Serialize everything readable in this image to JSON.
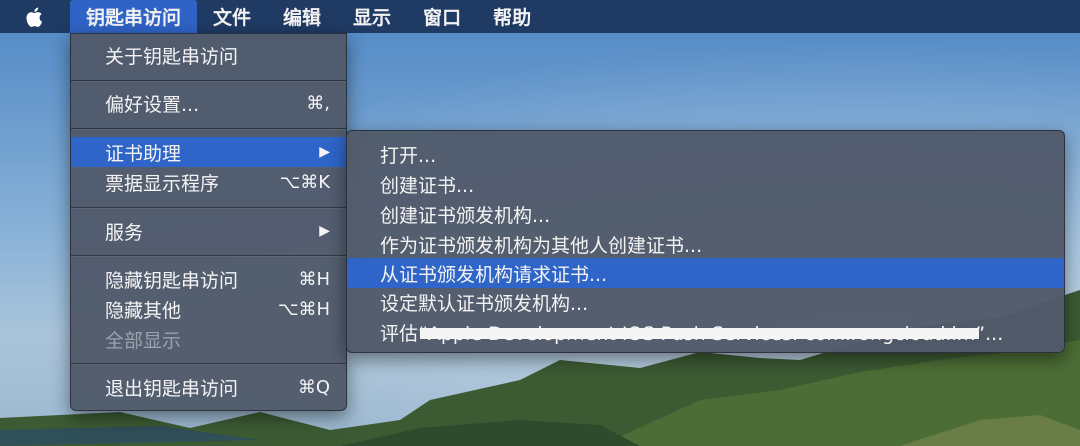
{
  "menubar": {
    "apple_icon": "apple-logo-icon",
    "items": [
      "钥匙串访问",
      "文件",
      "编辑",
      "显示",
      "窗口",
      "帮助"
    ]
  },
  "app_menu": {
    "items": [
      {
        "label": "关于钥匙串访问",
        "shortcut": ""
      },
      {
        "label": "偏好设置...",
        "shortcut": "⌘,"
      },
      {
        "label": "证书助理",
        "shortcut": "▶"
      },
      {
        "label": "票据显示程序",
        "shortcut": "⌥⌘K"
      },
      {
        "label": "服务",
        "shortcut": "▶"
      },
      {
        "label": "隐藏钥匙串访问",
        "shortcut": "⌘H"
      },
      {
        "label": "隐藏其他",
        "shortcut": "⌥⌘H"
      },
      {
        "label": "全部显示",
        "shortcut": ""
      },
      {
        "label": "退出钥匙串访问",
        "shortcut": "⌘Q"
      }
    ]
  },
  "submenu": {
    "items": [
      "打开...",
      "创建证书...",
      "创建证书颁发机构...",
      "作为证书颁发机构为其他人创建证书...",
      "从证书颁发机构请求证书...",
      "设定默认证书颁发机构...",
      "评估“Apple Development IOS Push Services: com.rongcloud.im”..."
    ]
  },
  "colors": {
    "menubar": "#1f3a63",
    "highlight": "#2f65c9",
    "menu_bg": "#505a6a"
  }
}
